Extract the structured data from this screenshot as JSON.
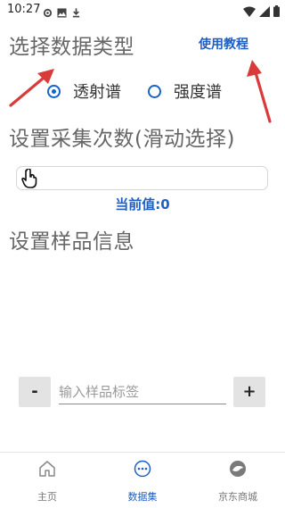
{
  "status_bar": {
    "time": "10:27"
  },
  "data_type": {
    "title": "选择数据类型",
    "help_link": "使用教程",
    "options": [
      {
        "label": "透射谱",
        "checked": true
      },
      {
        "label": "强度谱",
        "checked": false
      }
    ]
  },
  "collection": {
    "title": "设置采集次数(滑动选择)",
    "current_value": "当前值:0",
    "slider_value": 0
  },
  "sample": {
    "title": "设置样品信息",
    "minus_label": "-",
    "plus_label": "+",
    "input_placeholder": "输入样品标签",
    "input_value": ""
  },
  "bottom_nav": {
    "items": [
      {
        "label": "主页",
        "icon": "home-icon",
        "active": false
      },
      {
        "label": "数据集",
        "icon": "dataset-icon",
        "active": true
      },
      {
        "label": "京东商城",
        "icon": "jd-mall-icon",
        "active": false
      }
    ]
  },
  "colors": {
    "accent": "#1762c5",
    "annotation_arrow": "#d93a3a"
  }
}
